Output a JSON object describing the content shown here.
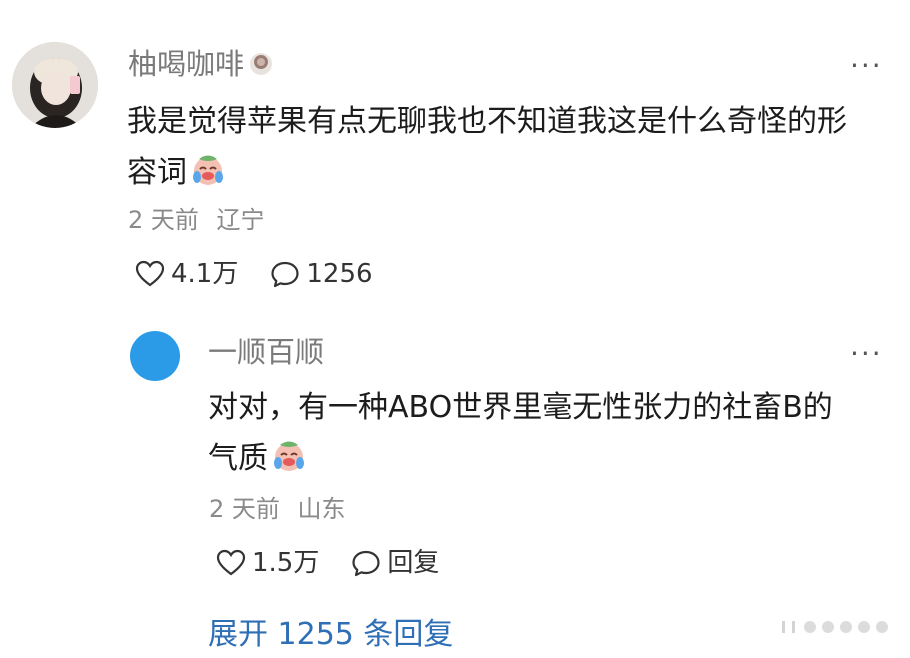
{
  "comment1": {
    "username": "柚喝咖啡",
    "text": "我是觉得苹果有点无聊我也不知道我这是什么奇怪的形容词",
    "text_line1": "我是觉得苹果有点无聊我也不知道我这是什么奇怪的形",
    "text_line2": "容词",
    "time": "2 天前",
    "location": "辽宁",
    "likes": "4.1万",
    "replies": "1256"
  },
  "comment2": {
    "username": "一顺百顺",
    "text_line1": "对对，有一种ABO世界里毫无性张力的社畜B的",
    "text_line2": "气质",
    "time": "2 天前",
    "location": "山东",
    "likes": "1.5万",
    "reply_label": "回复"
  },
  "expand_label": "展开 1255 条回复",
  "more_label": "···",
  "colors": {
    "link": "#2f6fb5",
    "meta": "#8a8a8a",
    "avatar2": "#2b9be8"
  }
}
